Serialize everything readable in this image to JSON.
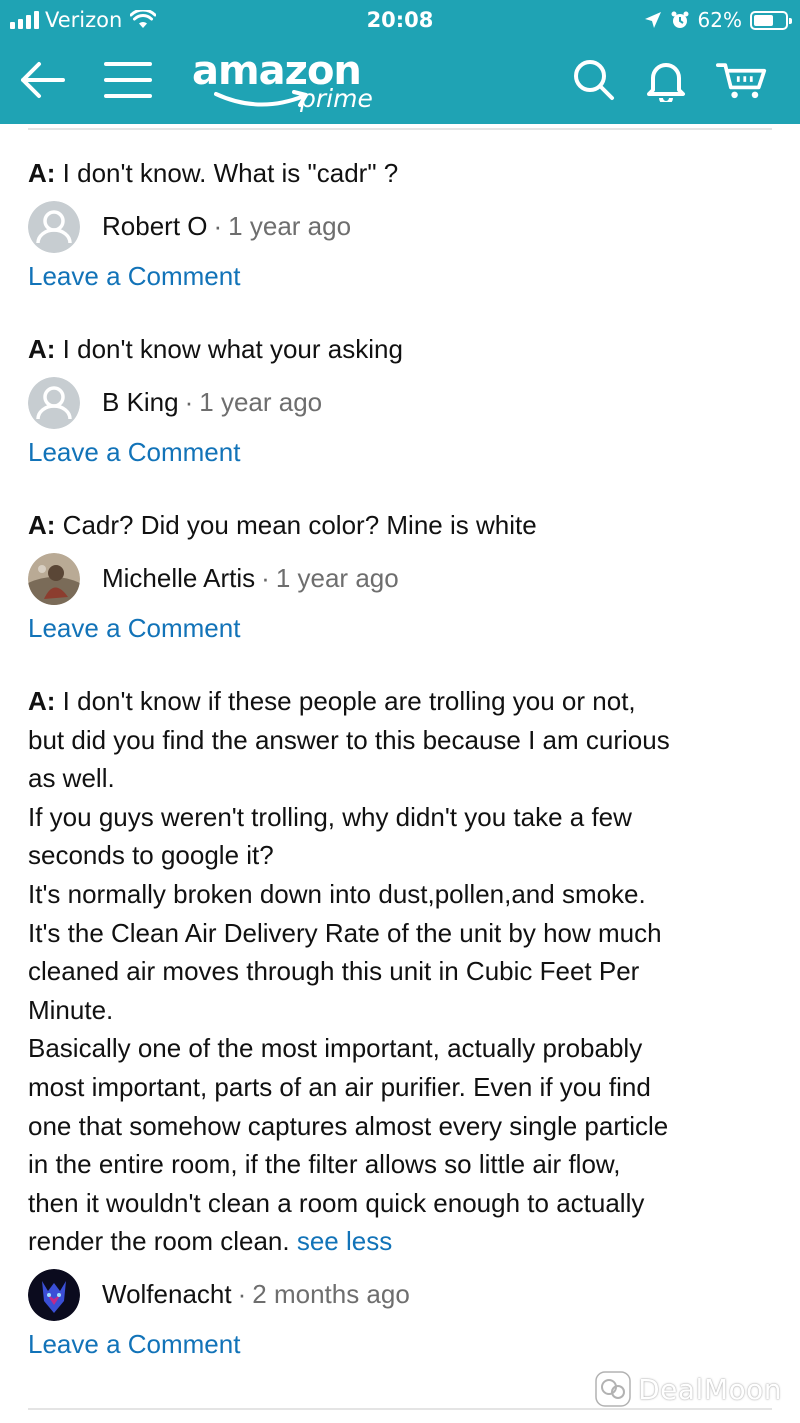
{
  "status_bar": {
    "carrier": "Verizon",
    "time": "20:08",
    "battery_percent": "62%",
    "battery_level": 0.62
  },
  "nav": {
    "logo_wordmark": "amazon",
    "logo_sub": "prime",
    "icons": [
      "back-arrow-icon",
      "menu-icon",
      "search-icon",
      "bell-icon",
      "cart-icon"
    ]
  },
  "answers": [
    {
      "prefix": "A:",
      "text": " I don't know. What is \"cadr\" ?",
      "author": "Robert O",
      "separator": "·",
      "date": "1 year ago",
      "comment_link": "Leave a Comment"
    },
    {
      "prefix": "A:",
      "text": " I don't know what your asking",
      "author": "B King",
      "separator": "·",
      "date": "1 year ago",
      "comment_link": "Leave a Comment"
    },
    {
      "prefix": "A:",
      "text": " Cadr? Did you mean color? Mine is white",
      "author": "Michelle Artis",
      "separator": "·",
      "date": "1 year ago",
      "comment_link": "Leave a Comment"
    },
    {
      "prefix": "A:",
      "lines": [
        " I don't know if these people are trolling you or not,",
        "but did you find the answer to this because I am curious",
        "as well.",
        "If you guys weren't trolling, why didn't you take a few",
        "seconds to google it?",
        "It's normally broken down into dust,pollen,and smoke.",
        "It's the Clean Air Delivery Rate of the unit by how much",
        "cleaned air moves through this unit in Cubic Feet Per",
        "Minute.",
        "Basically one of the most important, actually probably",
        "most important, parts of an air purifier. Even if you find",
        "one that somehow captures almost every single particle",
        "in the entire room, if the filter allows so little air flow,",
        "then it wouldn't clean a room quick enough to actually",
        "render the room clean."
      ],
      "see_less": "see less",
      "author": "Wolfenacht",
      "separator": "·",
      "date": "2 months ago",
      "comment_link": "Leave a Comment"
    }
  ],
  "watermark": "DealMoon",
  "colors": {
    "header": "#1fa3b4",
    "link": "#1273b8"
  }
}
